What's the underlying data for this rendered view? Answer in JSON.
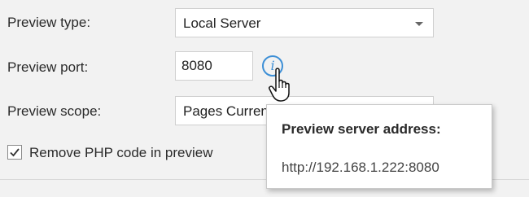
{
  "form": {
    "preview_type_label": "Preview type:",
    "preview_type_value": "Local Server",
    "preview_port_label": "Preview port:",
    "preview_port_value": "8080",
    "preview_scope_label": "Preview scope:",
    "preview_scope_value": "Pages Current Page",
    "remove_php_label": "Remove PHP code in preview",
    "remove_php_checked": true
  },
  "info_icon": {
    "glyph": "i",
    "name": "info-icon"
  },
  "tooltip": {
    "title": "Preview server address:",
    "address": "http://192.168.1.222:8080"
  },
  "colors": {
    "accent": "#3d8fd6"
  }
}
